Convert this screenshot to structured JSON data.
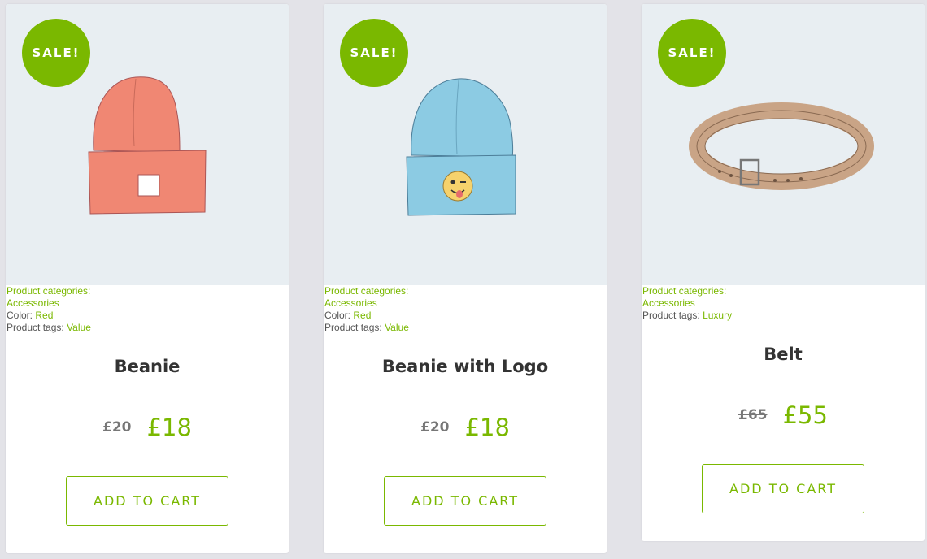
{
  "sale_badge": "SALE!",
  "products": [
    {
      "name": "Beanie",
      "categories_label": "Product categories:",
      "category": "Accessories",
      "color_label": "Color:",
      "color_value": "Red",
      "tags_label": "Product tags:",
      "tag": "Value",
      "old_price": "£20",
      "new_price": "£18",
      "button": "ADD TO CART",
      "image": "red-beanie"
    },
    {
      "name": "Beanie with Logo",
      "categories_label": "Product categories:",
      "category": "Accessories",
      "color_label": "Color:",
      "color_value": "Red",
      "tags_label": "Product tags:",
      "tag": "Value",
      "old_price": "£20",
      "new_price": "£18",
      "button": "ADD TO CART",
      "image": "blue-beanie-with-emoji-logo"
    },
    {
      "name": "Belt",
      "categories_label": "Product categories:",
      "category": "Accessories",
      "tags_label": "Product tags:",
      "tag": "Luxury",
      "old_price": "£65",
      "new_price": "£55",
      "button": "ADD TO CART",
      "image": "leather-belt"
    }
  ],
  "colors": {
    "accent": "#7ab800",
    "background": "#e3e3e8",
    "image_bg": "#e8eef2",
    "text": "#333333"
  }
}
